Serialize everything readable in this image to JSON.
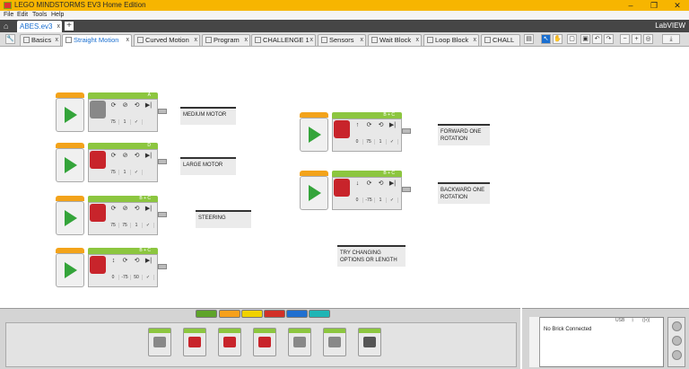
{
  "window": {
    "title": "LEGO MINDSTORMS EV3 Home Edition",
    "minimize": "–",
    "maximize": "❐",
    "close": "✕"
  },
  "menu": [
    "File",
    "Edit",
    "Tools",
    "Help"
  ],
  "project": {
    "tab_label": "ABES.ev3",
    "close": "x",
    "add": "+",
    "brand": "LabVIEW"
  },
  "tabs": [
    {
      "label": "Basics"
    },
    {
      "label": "Straight Motion"
    },
    {
      "label": "Curved Motion"
    },
    {
      "label": "Program"
    },
    {
      "label": "CHALLENGE 1"
    },
    {
      "label": "Sensors"
    },
    {
      "label": "Wait Block"
    },
    {
      "label": "Loop Block"
    },
    {
      "label": "CHALL"
    }
  ],
  "blocks": [
    {
      "port": "A",
      "mode_color": "grey",
      "icons": [
        "⟳",
        "⊘",
        "⟲",
        "▶|"
      ],
      "values": [
        "75",
        "1",
        "✓"
      ]
    },
    {
      "port": "D",
      "mode_color": "red",
      "icons": [
        "⟳",
        "⊘",
        "⟲",
        "▶|"
      ],
      "values": [
        "75",
        "1",
        "✓"
      ]
    },
    {
      "port": "B + C",
      "mode_color": "red",
      "icons": [
        "⟳",
        "⊘",
        "⟲",
        "▶|"
      ],
      "values": [
        "75",
        "75",
        "1",
        "✓"
      ]
    },
    {
      "port": "B + C",
      "mode_color": "red",
      "icons": [
        "↕",
        "⟳",
        "⟲",
        "▶|"
      ],
      "values": [
        "0",
        "-75",
        "50",
        "✓"
      ]
    },
    {
      "port": "B + C",
      "mode_color": "red",
      "icons": [
        "↑",
        "⟳",
        "⟲",
        "▶|"
      ],
      "values": [
        "0",
        "75",
        "1",
        "✓"
      ]
    },
    {
      "port": "B + C",
      "mode_color": "red",
      "icons": [
        "↓",
        "⟳",
        "⟲",
        "▶|"
      ],
      "values": [
        "0",
        "-75",
        "1",
        "✓"
      ]
    }
  ],
  "comments": [
    "MEDIUM MOTOR",
    "LARGE MOTOR",
    "STEERING",
    "FORWARD ONE\nROTATION",
    "BACKWARD ONE\nROTATION",
    "TRY CHANGING\nOPTIONS OR LENGTH"
  ],
  "palette": {
    "tab_colors": [
      "#5ea429",
      "#f6a01b",
      "#f0d200",
      "#d22f27",
      "#1f6fd0",
      "#1fb5b5"
    ],
    "block_icon_colors": [
      "#888888",
      "#c8242b",
      "#c8242b",
      "#c8242b",
      "#888888",
      "#888888",
      "#555555"
    ]
  },
  "hardware": {
    "status": "No Brick Connected",
    "usb": "USB",
    "bluetooth": "ᛒ",
    "wifi": "((•))"
  }
}
